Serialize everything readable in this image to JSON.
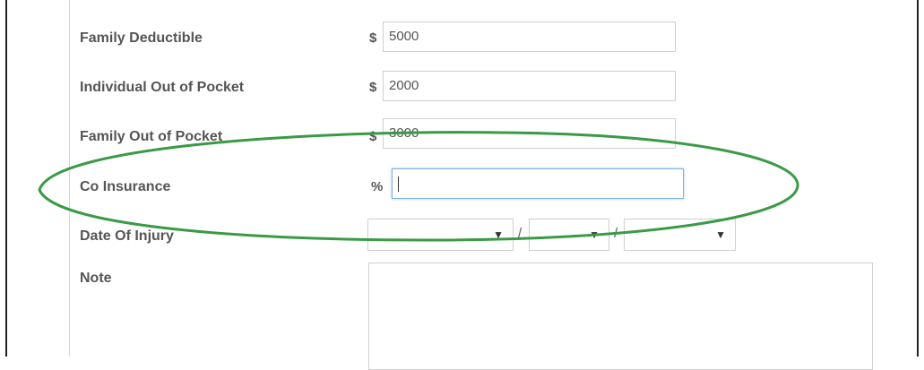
{
  "form": {
    "family_deductible": {
      "label": "Family Deductible",
      "prefix": "$",
      "value": "5000"
    },
    "individual_oop": {
      "label": "Individual Out of Pocket",
      "prefix": "$",
      "value": "2000"
    },
    "family_oop": {
      "label": "Family Out of Pocket",
      "prefix": "$",
      "value": "3000"
    },
    "co_insurance": {
      "label": "Co Insurance",
      "prefix": "%",
      "value": ""
    },
    "date_of_injury": {
      "label": "Date Of Injury",
      "separator": "/"
    },
    "note": {
      "label": "Note"
    }
  },
  "annotation": {
    "color": "#3a9a45"
  }
}
